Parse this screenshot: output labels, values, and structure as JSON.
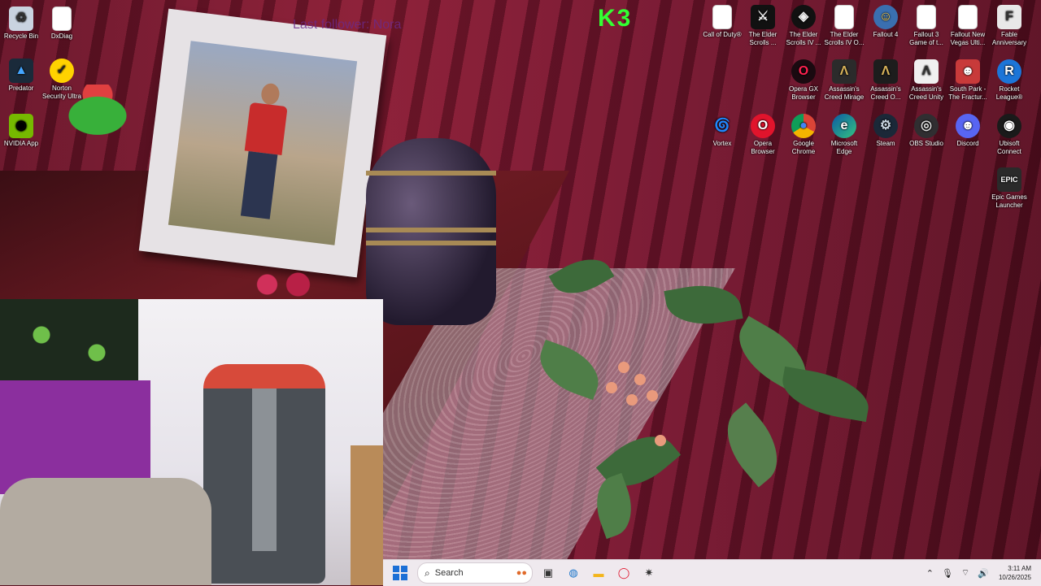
{
  "desktop": {
    "left_icons": [
      {
        "label": "Recycle Bin",
        "icon": "recycle-bin-icon"
      },
      {
        "label": "DxDiag",
        "icon": "document-icon"
      },
      {
        "label": "Predator",
        "icon": "predator-icon"
      },
      {
        "label": "Norton Security Ultra",
        "icon": "norton-icon"
      },
      {
        "label": "NVIDIA App",
        "icon": "nvidia-icon"
      }
    ],
    "right_icons": [
      {
        "label": "Call of Duty®",
        "icon": "document-icon"
      },
      {
        "label": "The Elder Scrolls ...",
        "icon": "elder-scrolls-icon"
      },
      {
        "label": "The Elder Scrolls IV ...",
        "icon": "elder-scrolls-icon"
      },
      {
        "label": "The Elder Scrolls IV O...",
        "icon": "document-icon"
      },
      {
        "label": "Fallout 4",
        "icon": "fallout-icon"
      },
      {
        "label": "Fallout 3 Game of t...",
        "icon": "document-icon"
      },
      {
        "label": "Fallout New Vegas Ulti...",
        "icon": "document-icon"
      },
      {
        "label": "Fable Anniversary",
        "icon": "fable-icon"
      },
      {
        "label": "Opera GX Browser",
        "icon": "opera-gx-icon"
      },
      {
        "label": "Assassin's Creed Mirage",
        "icon": "assassins-creed-icon"
      },
      {
        "label": "Assassin's Creed O...",
        "icon": "assassins-creed-icon"
      },
      {
        "label": "Assassin's Creed Unity",
        "icon": "assassins-creed-icon"
      },
      {
        "label": "South Park - The Fractur...",
        "icon": "south-park-icon"
      },
      {
        "label": "Rocket League®",
        "icon": "rocket-league-icon"
      },
      {
        "label": "Vortex",
        "icon": "vortex-icon"
      },
      {
        "label": "Opera Browser",
        "icon": "opera-icon"
      },
      {
        "label": "Google Chrome",
        "icon": "chrome-icon"
      },
      {
        "label": "Microsoft Edge",
        "icon": "edge-icon"
      },
      {
        "label": "Steam",
        "icon": "steam-icon"
      },
      {
        "label": "OBS Studio",
        "icon": "obs-icon"
      },
      {
        "label": "Discord",
        "icon": "discord-icon"
      },
      {
        "label": "Ubisoft Connect",
        "icon": "ubisoft-icon"
      },
      {
        "label": "Epic Games Launcher",
        "icon": "epic-games-icon"
      }
    ],
    "overlay_text": "Last follower: Nora",
    "overlay_badge": "K3"
  },
  "taskbar": {
    "search_placeholder": "Search",
    "apps": [
      "copilot-icon",
      "task-view-icon",
      "edge-icon",
      "file-explorer-icon",
      "opera-icon",
      "app-icon"
    ],
    "time": "3:11 AM",
    "date": "10/26/2025"
  },
  "colors": {
    "accent": "#1c6fd6",
    "taskbar_bg": "#efe9ee",
    "wallpaper": "#8b1b34"
  }
}
